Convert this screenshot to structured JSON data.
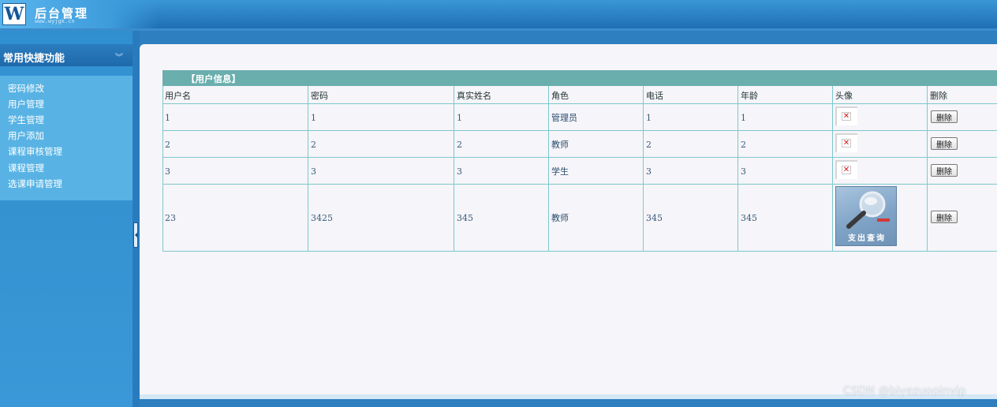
{
  "header": {
    "logo_letter": "W",
    "title": "后台管理",
    "subtitle": "www.wyjgk.cn"
  },
  "sidebar": {
    "section_title": "常用快捷功能",
    "items": [
      {
        "label": "密码修改"
      },
      {
        "label": "用户管理"
      },
      {
        "label": "学生管理"
      },
      {
        "label": "用户添加"
      },
      {
        "label": "课程审核管理"
      },
      {
        "label": "课程管理"
      },
      {
        "label": "选课申请管理"
      }
    ]
  },
  "panel": {
    "title": "【用户信息】"
  },
  "table": {
    "columns": [
      "用户名",
      "密码",
      "真实姓名",
      "角色",
      "电话",
      "年龄",
      "头像",
      "删除"
    ],
    "rows": [
      {
        "username": "1",
        "password": "1",
        "realname": "1",
        "role": "管理员",
        "phone": "1",
        "age": "1",
        "avatar": "broken-image-icon",
        "delete_label": "删除"
      },
      {
        "username": "2",
        "password": "2",
        "realname": "2",
        "role": "教师",
        "phone": "2",
        "age": "2",
        "avatar": "broken-image-icon",
        "delete_label": "删除"
      },
      {
        "username": "3",
        "password": "3",
        "realname": "3",
        "role": "学生",
        "phone": "3",
        "age": "3",
        "avatar": "broken-image-icon",
        "delete_label": "删除"
      },
      {
        "username": "23",
        "password": "3425",
        "realname": "345",
        "role": "教师",
        "phone": "345",
        "age": "345",
        "avatar": "magnifier-image",
        "avatar_caption": "支出查询",
        "delete_label": "删除"
      }
    ]
  },
  "watermark": "CSDN @biyezuopinvip",
  "colors": {
    "header_blue": "#2a7fc3",
    "sidebar_blue": "#3a9bd9",
    "table_header": "#6aaeae",
    "table_border": "#7ec8cc",
    "broken_x": "#d41a1a"
  }
}
